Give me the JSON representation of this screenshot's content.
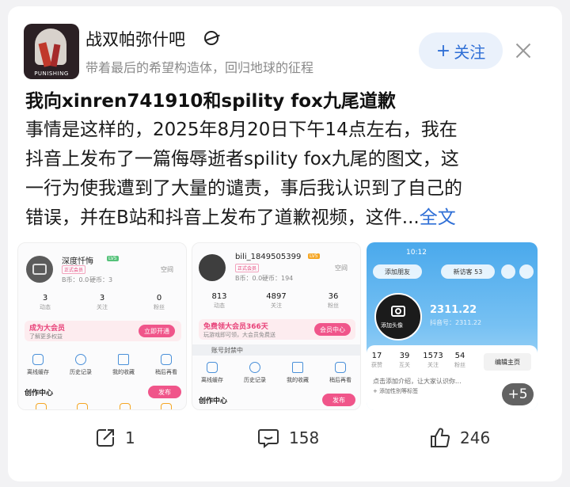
{
  "forum": {
    "name": "战双帕弥什吧",
    "description": "带着最后的希望构造体，回归地球的征程",
    "follow_label": "关注",
    "follow_plus": "+",
    "avatar_brand": "PUNISHING"
  },
  "post": {
    "title": "我向xinren741910和spility fox九尾道歉",
    "body_lines": [
      "事情是这样的，2025年8月20日下午14点左右，我在",
      "抖音上发布了一篇侮辱逝者spility fox九尾的图文，这",
      "一行为使我遭到了大量的谴责，事后我认识到了自己的",
      "错误，并在B站和抖音上发布了道歉视频，这件..."
    ],
    "full_link": "全文"
  },
  "thumbnails": [
    {
      "name": "深度忏悔",
      "level": "LV5",
      "tag": "正式会员",
      "b_coin": "B币：0.0",
      "hard_coin": "硬币：3",
      "space": "空间",
      "stats": [
        {
          "num": "3",
          "label": "动态"
        },
        {
          "num": "3",
          "label": "关注"
        },
        {
          "num": "0",
          "label": "粉丝"
        }
      ],
      "vip_title": "成为大会员",
      "vip_sub": "了解更多权益",
      "vip_btn": "立即开通",
      "icons": [
        "离线缓存",
        "历史记录",
        "我的收藏",
        "稍后再看"
      ],
      "creation": "创作中心",
      "publish": "发布"
    },
    {
      "name": "bili_1849505399",
      "level": "LV5",
      "tag": "正式会员",
      "b_coin": "B币：0.0",
      "hard_coin": "硬币：194",
      "space": "空间",
      "stats": [
        {
          "num": "813",
          "label": "动态"
        },
        {
          "num": "4897",
          "label": "关注"
        },
        {
          "num": "36",
          "label": "粉丝"
        }
      ],
      "vip_title": "免费领大会员366天",
      "vip_sub": "玩游戏即可领，大会员免费送",
      "vip_btn": "会员中心",
      "notice": "账号封禁中",
      "icons": [
        "离线缓存",
        "历史记录",
        "我的收藏",
        "稍后再看"
      ],
      "creation": "创作中心",
      "publish": "发布"
    },
    {
      "time": "10:12",
      "add_friend": "添加朋友",
      "visitors": "新访客 53",
      "avatar_label": "添加头像",
      "name": "2311.22",
      "douyin_id": "抖音号：2311.22",
      "stats": [
        {
          "num": "17",
          "label": "获赞"
        },
        {
          "num": "39",
          "label": "互关"
        },
        {
          "num": "1573",
          "label": "关注"
        },
        {
          "num": "54",
          "label": "粉丝"
        }
      ],
      "edit": "编辑主页",
      "intro": "点击添加介绍，让大家认识你...",
      "tags": "+ 添加性别等标签",
      "more": "+5"
    }
  ],
  "actions": {
    "share_count": "1",
    "comment_count": "158",
    "like_count": "246"
  }
}
